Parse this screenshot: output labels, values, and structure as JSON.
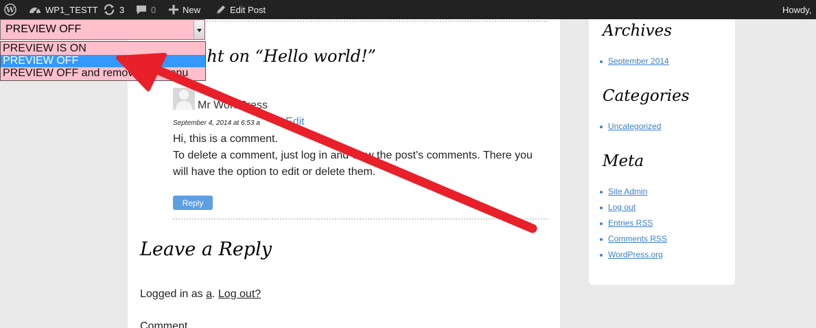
{
  "adminbar": {
    "site_name": "WP1_TESTT",
    "updates_count": "3",
    "comments_count": "0",
    "new_label": "New",
    "edit_label": "Edit Post",
    "howdy": "Howdy,"
  },
  "comments": {
    "title": "ght on “Hello world!”",
    "author": "Mr WordPress",
    "date": "September 4, 2014 at 6:53 a",
    "edit": "Edit",
    "body_line1": "Hi, this is a comment.",
    "body_line2": "To delete a comment, just log in and view the post's comments. There you will have the option to edit or delete them.",
    "reply": "Reply"
  },
  "reply_form": {
    "heading": "Leave a Reply",
    "logged_in_prefix": "Logged in as",
    "user": "a",
    "logout": "Log out?",
    "comment_label": "Comment"
  },
  "sidebar": {
    "archives_title": "Archives",
    "archives": [
      "September 2014"
    ],
    "categories_title": "Categories",
    "categories": [
      "Uncategorized"
    ],
    "meta_title": "Meta",
    "meta": [
      "Site Admin",
      "Log out",
      "Entries RSS",
      "Comments RSS",
      "WordPress.org"
    ]
  },
  "preview_select": {
    "selected": "PREVIEW OFF",
    "options": [
      "PREVIEW IS ON",
      "PREVIEW OFF",
      "PREVIEW OFF and remove the menu"
    ],
    "highlighted_index": 1
  },
  "colors": {
    "adminbar_bg": "#222222",
    "select_bg": "#ffc0cb",
    "highlight": "#3399ff",
    "link": "#3a7fc9",
    "arrow": "#e8202a"
  },
  "icons": [
    "wordpress-logo-icon",
    "dashboard-icon",
    "updates-icon",
    "comments-icon",
    "plus-icon",
    "pencil-icon",
    "chevron-down-icon"
  ]
}
